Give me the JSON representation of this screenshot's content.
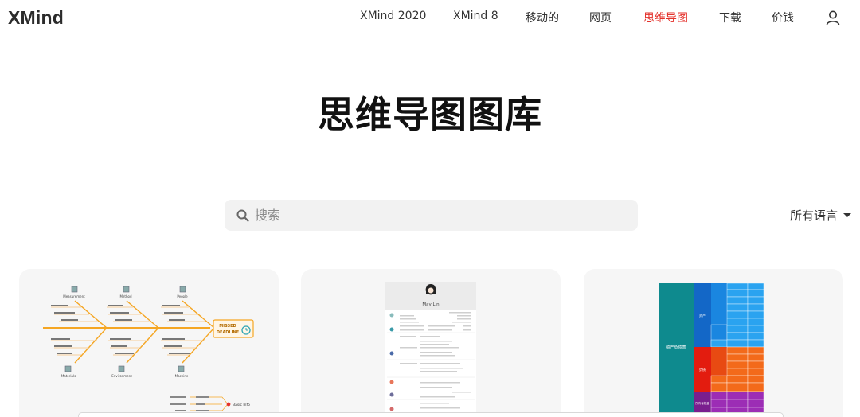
{
  "header": {
    "logo": "XMind",
    "nav": [
      {
        "label": "XMind 2020",
        "active": false
      },
      {
        "label": "XMind 8",
        "active": false
      },
      {
        "label": "移动的",
        "active": false
      },
      {
        "label": "网页",
        "active": false
      },
      {
        "label": "思维导图",
        "active": true
      },
      {
        "label": "下载",
        "active": false
      },
      {
        "label": "价钱",
        "active": false
      }
    ],
    "user_icon": "user-icon"
  },
  "page": {
    "title": "思维导图图库"
  },
  "search": {
    "placeholder": "搜索",
    "value": ""
  },
  "language_filter": {
    "selected": "所有语言"
  },
  "colors": {
    "accent": "#e4322c",
    "search_bg": "#f2f2f2",
    "card_bg": "#f6f6f6",
    "fishbone_orange": "#f5a623"
  },
  "cards": [
    {
      "kind": "fishbone",
      "head": [
        "MISSED",
        "DEADLINE"
      ],
      "top_categories": [
        "Measurement",
        "Method",
        "People"
      ],
      "bottom_categories": [
        "Materials",
        "Environment",
        "Machine"
      ],
      "extra": "Basic Info"
    },
    {
      "kind": "resume",
      "name": "May Lin"
    },
    {
      "kind": "treemap",
      "root_label": "资产负债表",
      "mid_labels": [
        "资产",
        "负债",
        "所有者权益"
      ]
    }
  ]
}
